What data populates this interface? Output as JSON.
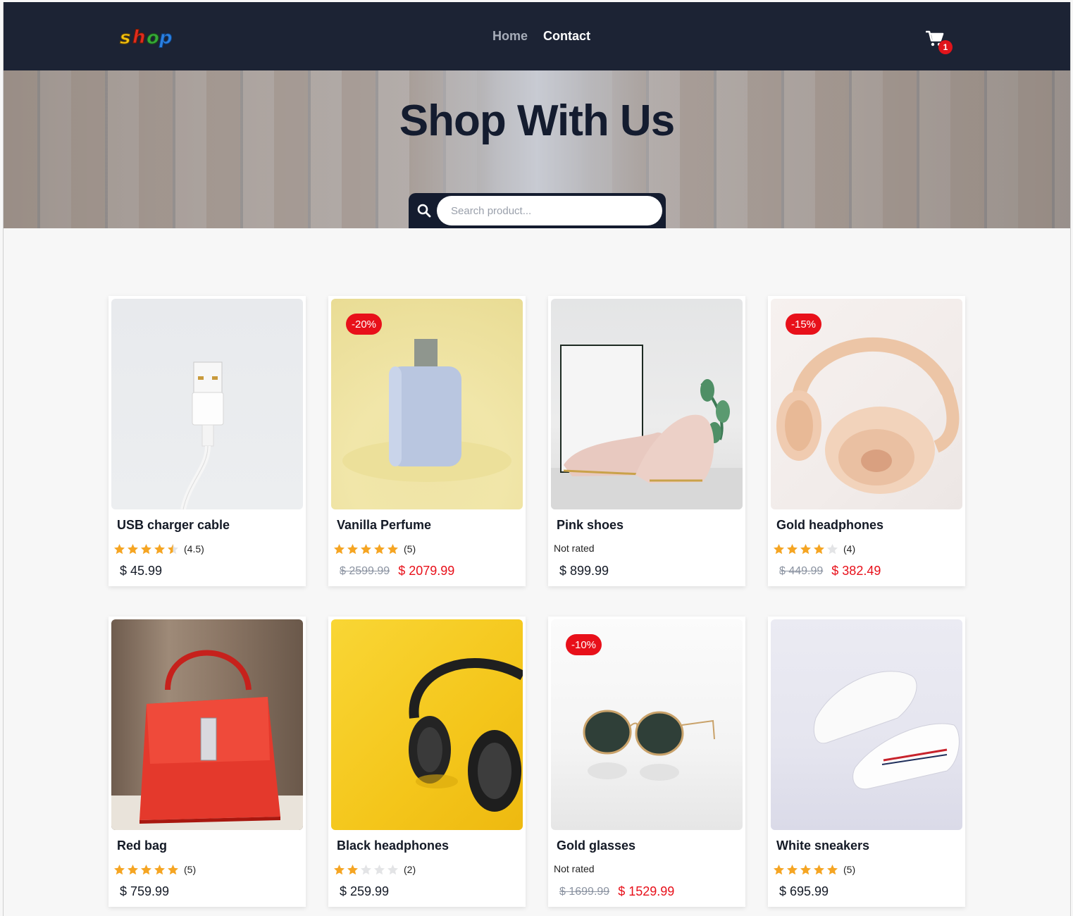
{
  "header": {
    "logo_text": "shop",
    "nav": [
      {
        "label": "Home"
      },
      {
        "label": "Contact"
      }
    ],
    "cart": {
      "icon": "cart-icon",
      "count": "1"
    }
  },
  "hero": {
    "title": "Shop With Us",
    "search": {
      "placeholder": "Search product...",
      "value": "",
      "icon": "search-icon"
    }
  },
  "colors": {
    "navbar": "#1c2334",
    "accent_red": "#e8101a",
    "star": "#f5a523",
    "star_empty": "#e3e4e6"
  },
  "products": [
    {
      "name": "USB charger cable",
      "rating_value": 4.5,
      "rating_text": "(4.5)",
      "price": "$ 45.99",
      "old_price": "",
      "badge": ""
    },
    {
      "name": "Vanilla Perfume",
      "rating_value": 5,
      "rating_text": "(5)",
      "price": "$ 2079.99",
      "old_price": "$ 2599.99",
      "badge": "-20%"
    },
    {
      "name": "Pink shoes",
      "rating_value": 0,
      "rating_text": "Not rated",
      "price": "$ 899.99",
      "old_price": "",
      "badge": ""
    },
    {
      "name": "Gold headphones",
      "rating_value": 4,
      "rating_text": "(4)",
      "price": "$ 382.49",
      "old_price": "$ 449.99",
      "badge": "-15%"
    },
    {
      "name": "Red bag",
      "rating_value": 5,
      "rating_text": "(5)",
      "price": "$ 759.99",
      "old_price": "",
      "badge": ""
    },
    {
      "name": "Black headphones",
      "rating_value": 2,
      "rating_text": "(2)",
      "price": "$ 259.99",
      "old_price": "",
      "badge": ""
    },
    {
      "name": "Gold glasses",
      "rating_value": 0,
      "rating_text": "Not rated",
      "price": "$ 1529.99",
      "old_price": "$ 1699.99",
      "badge": "-10%"
    },
    {
      "name": "White sneakers",
      "rating_value": 5,
      "rating_text": "(5)",
      "price": "$ 695.99",
      "old_price": "",
      "badge": ""
    }
  ]
}
